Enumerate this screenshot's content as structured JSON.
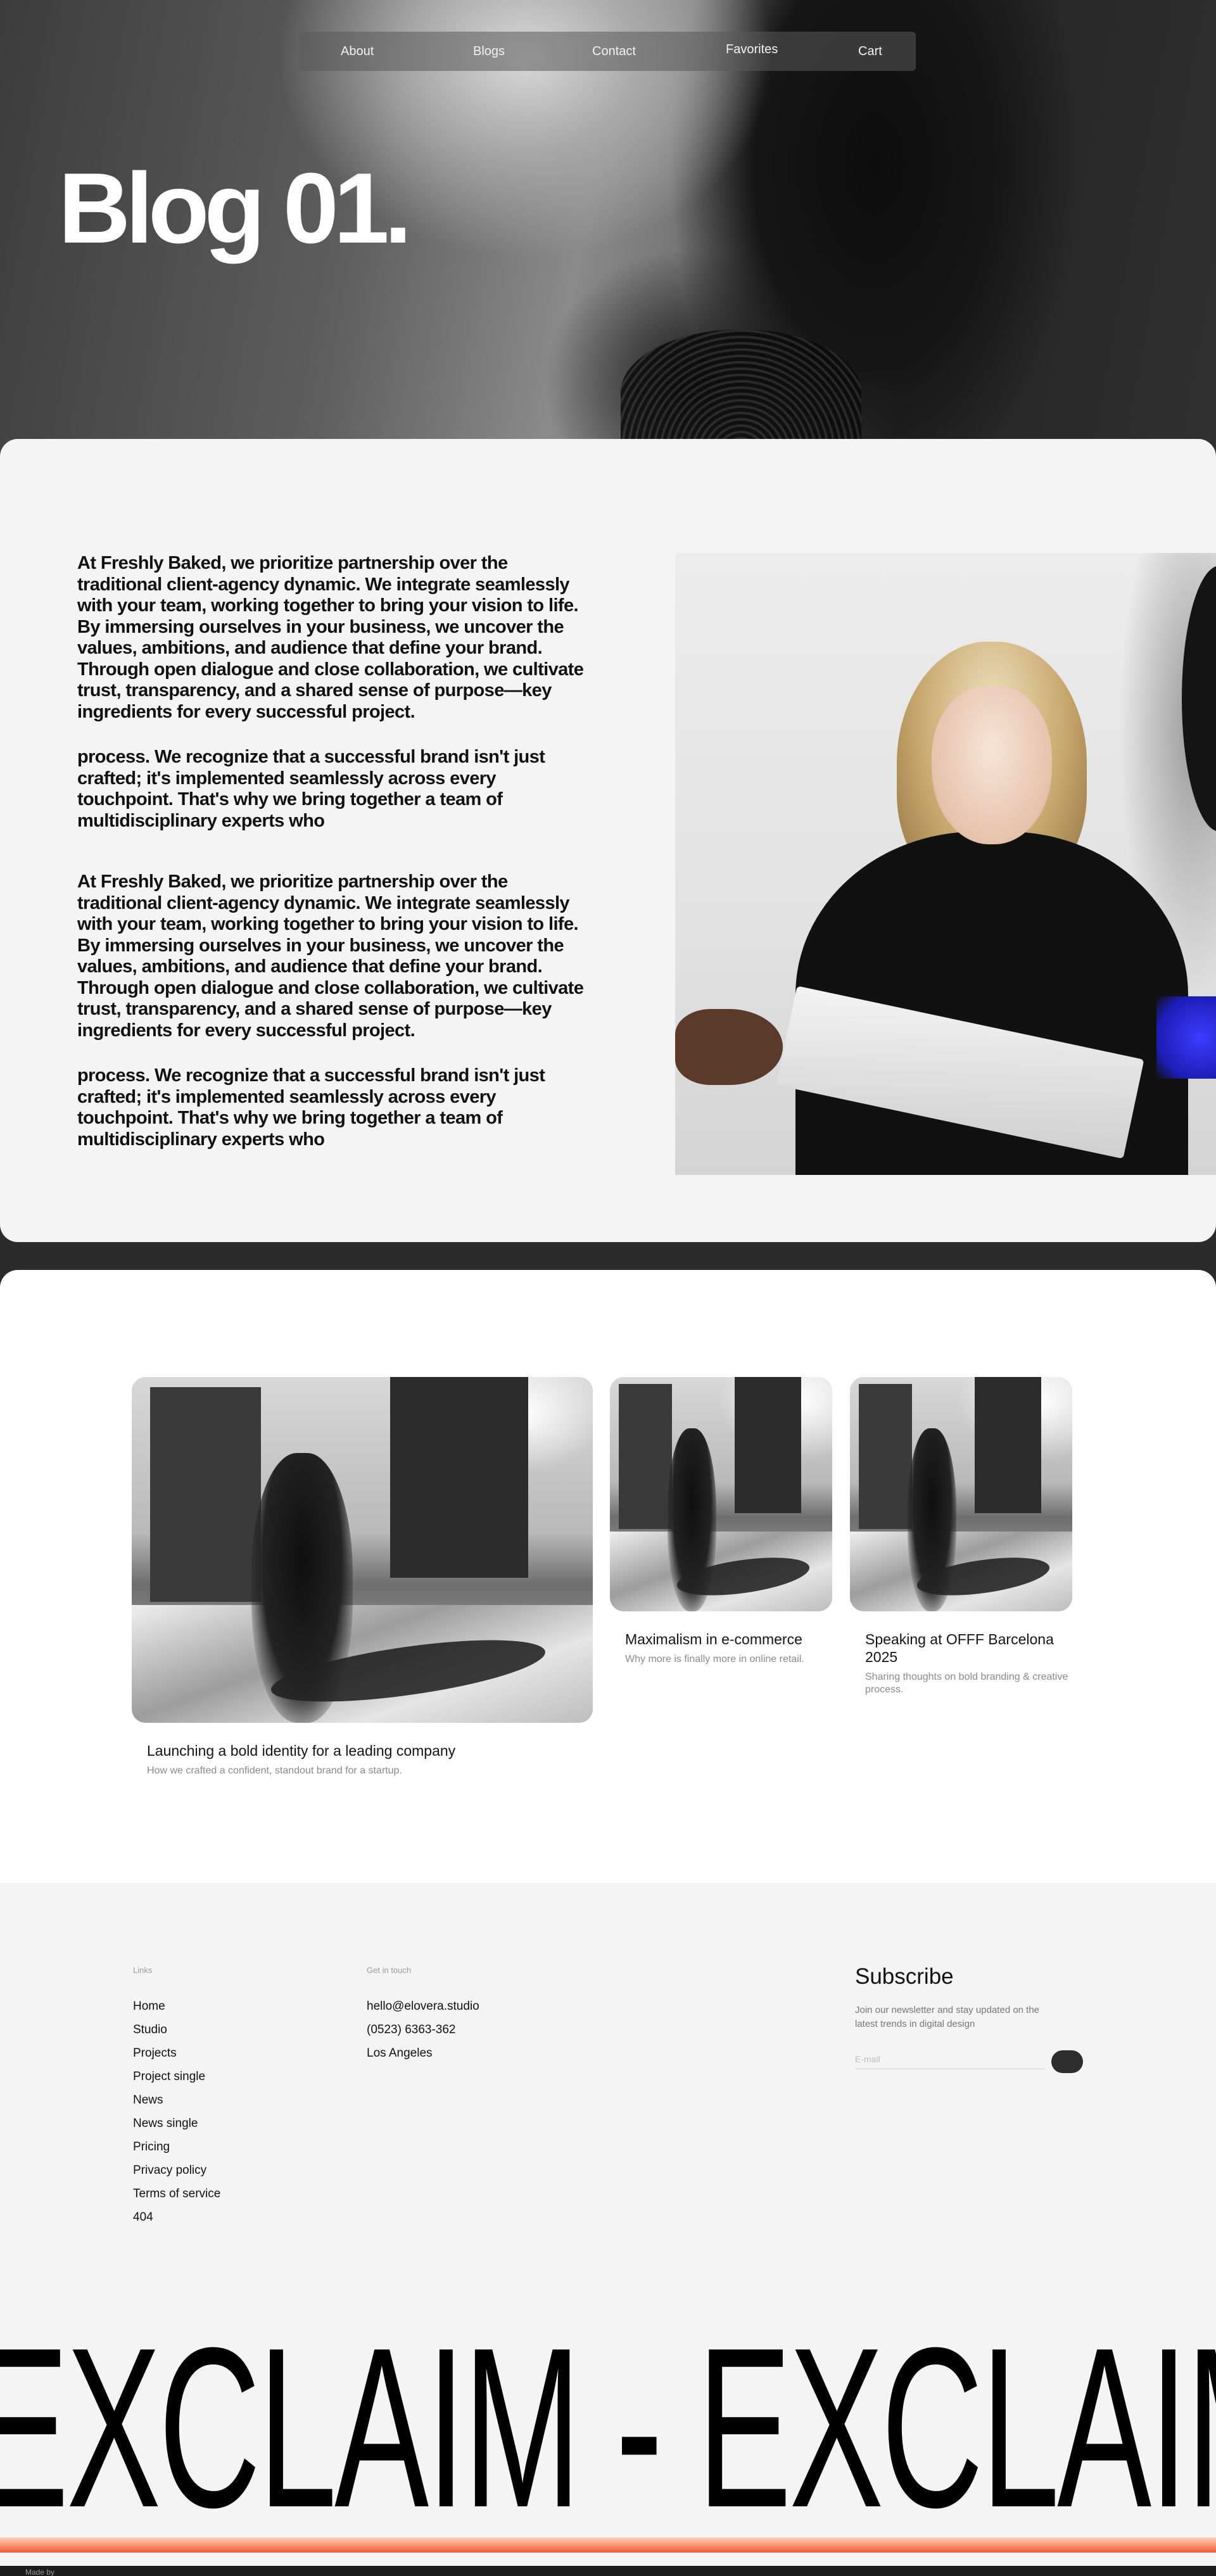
{
  "nav": {
    "items": [
      "About",
      "Blogs",
      "Contact",
      "Favorites",
      "Cart"
    ]
  },
  "hero": {
    "title": "Blog 01."
  },
  "article": {
    "paragraphs": [
      "At Freshly Baked, we prioritize partnership over the traditional client-agency dynamic. We integrate seamlessly with your team, working together to bring your vision to life. By immersing ourselves in your business, we uncover the values, ambitions, and audience that define your brand. Through open dialogue and close collaboration, we cultivate trust, transparency, and a shared sense of purpose—key ingredients for every successful project.",
      " process. We recognize that a successful brand isn't just crafted; it's implemented seamlessly across every touchpoint. That's why we bring together a team of multidisciplinary experts who",
      "At Freshly Baked, we prioritize partnership over the traditional client-agency dynamic. We integrate seamlessly with your team, working together to bring your vision to life. By immersing ourselves in your business, we uncover the values, ambitions, and audience that define your brand. Through open dialogue and close collaboration, we cultivate trust, transparency, and a shared sense of purpose—key ingredients for every successful project.",
      " process. We recognize that a successful brand isn't just crafted; it's implemented seamlessly across every touchpoint. That's why we bring together a team of multidisciplinary experts who"
    ]
  },
  "work": {
    "cards": [
      {
        "title": "Launching a bold identity for a leading company",
        "description": "How we crafted a confident, standout brand for a startup."
      },
      {
        "title": "Maximalism in e-commerce",
        "description": "Why more is finally more in online retail."
      },
      {
        "title": "Speaking at OFFF Barcelona 2025",
        "description": "Sharing thoughts on bold branding & creative process."
      }
    ]
  },
  "footer": {
    "links_label": "Links",
    "links": [
      "Home",
      "Studio",
      "Projects",
      "Project single",
      "News",
      "News single",
      "Pricing",
      "Privacy policy",
      "Terms of service",
      "404"
    ],
    "contact_label": "Get in touch",
    "contact": [
      "hello@elovera.studio",
      "(0523) 6363-362",
      "Los Angeles"
    ],
    "subscribe_title": "Subscribe",
    "subscribe_text": "Join our newsletter and stay updated on the latest trends in digital design",
    "email_placeholder": "E-mail",
    "big_word": "EXCLAIM - EXCLAIM",
    "made_by": "Made by"
  }
}
